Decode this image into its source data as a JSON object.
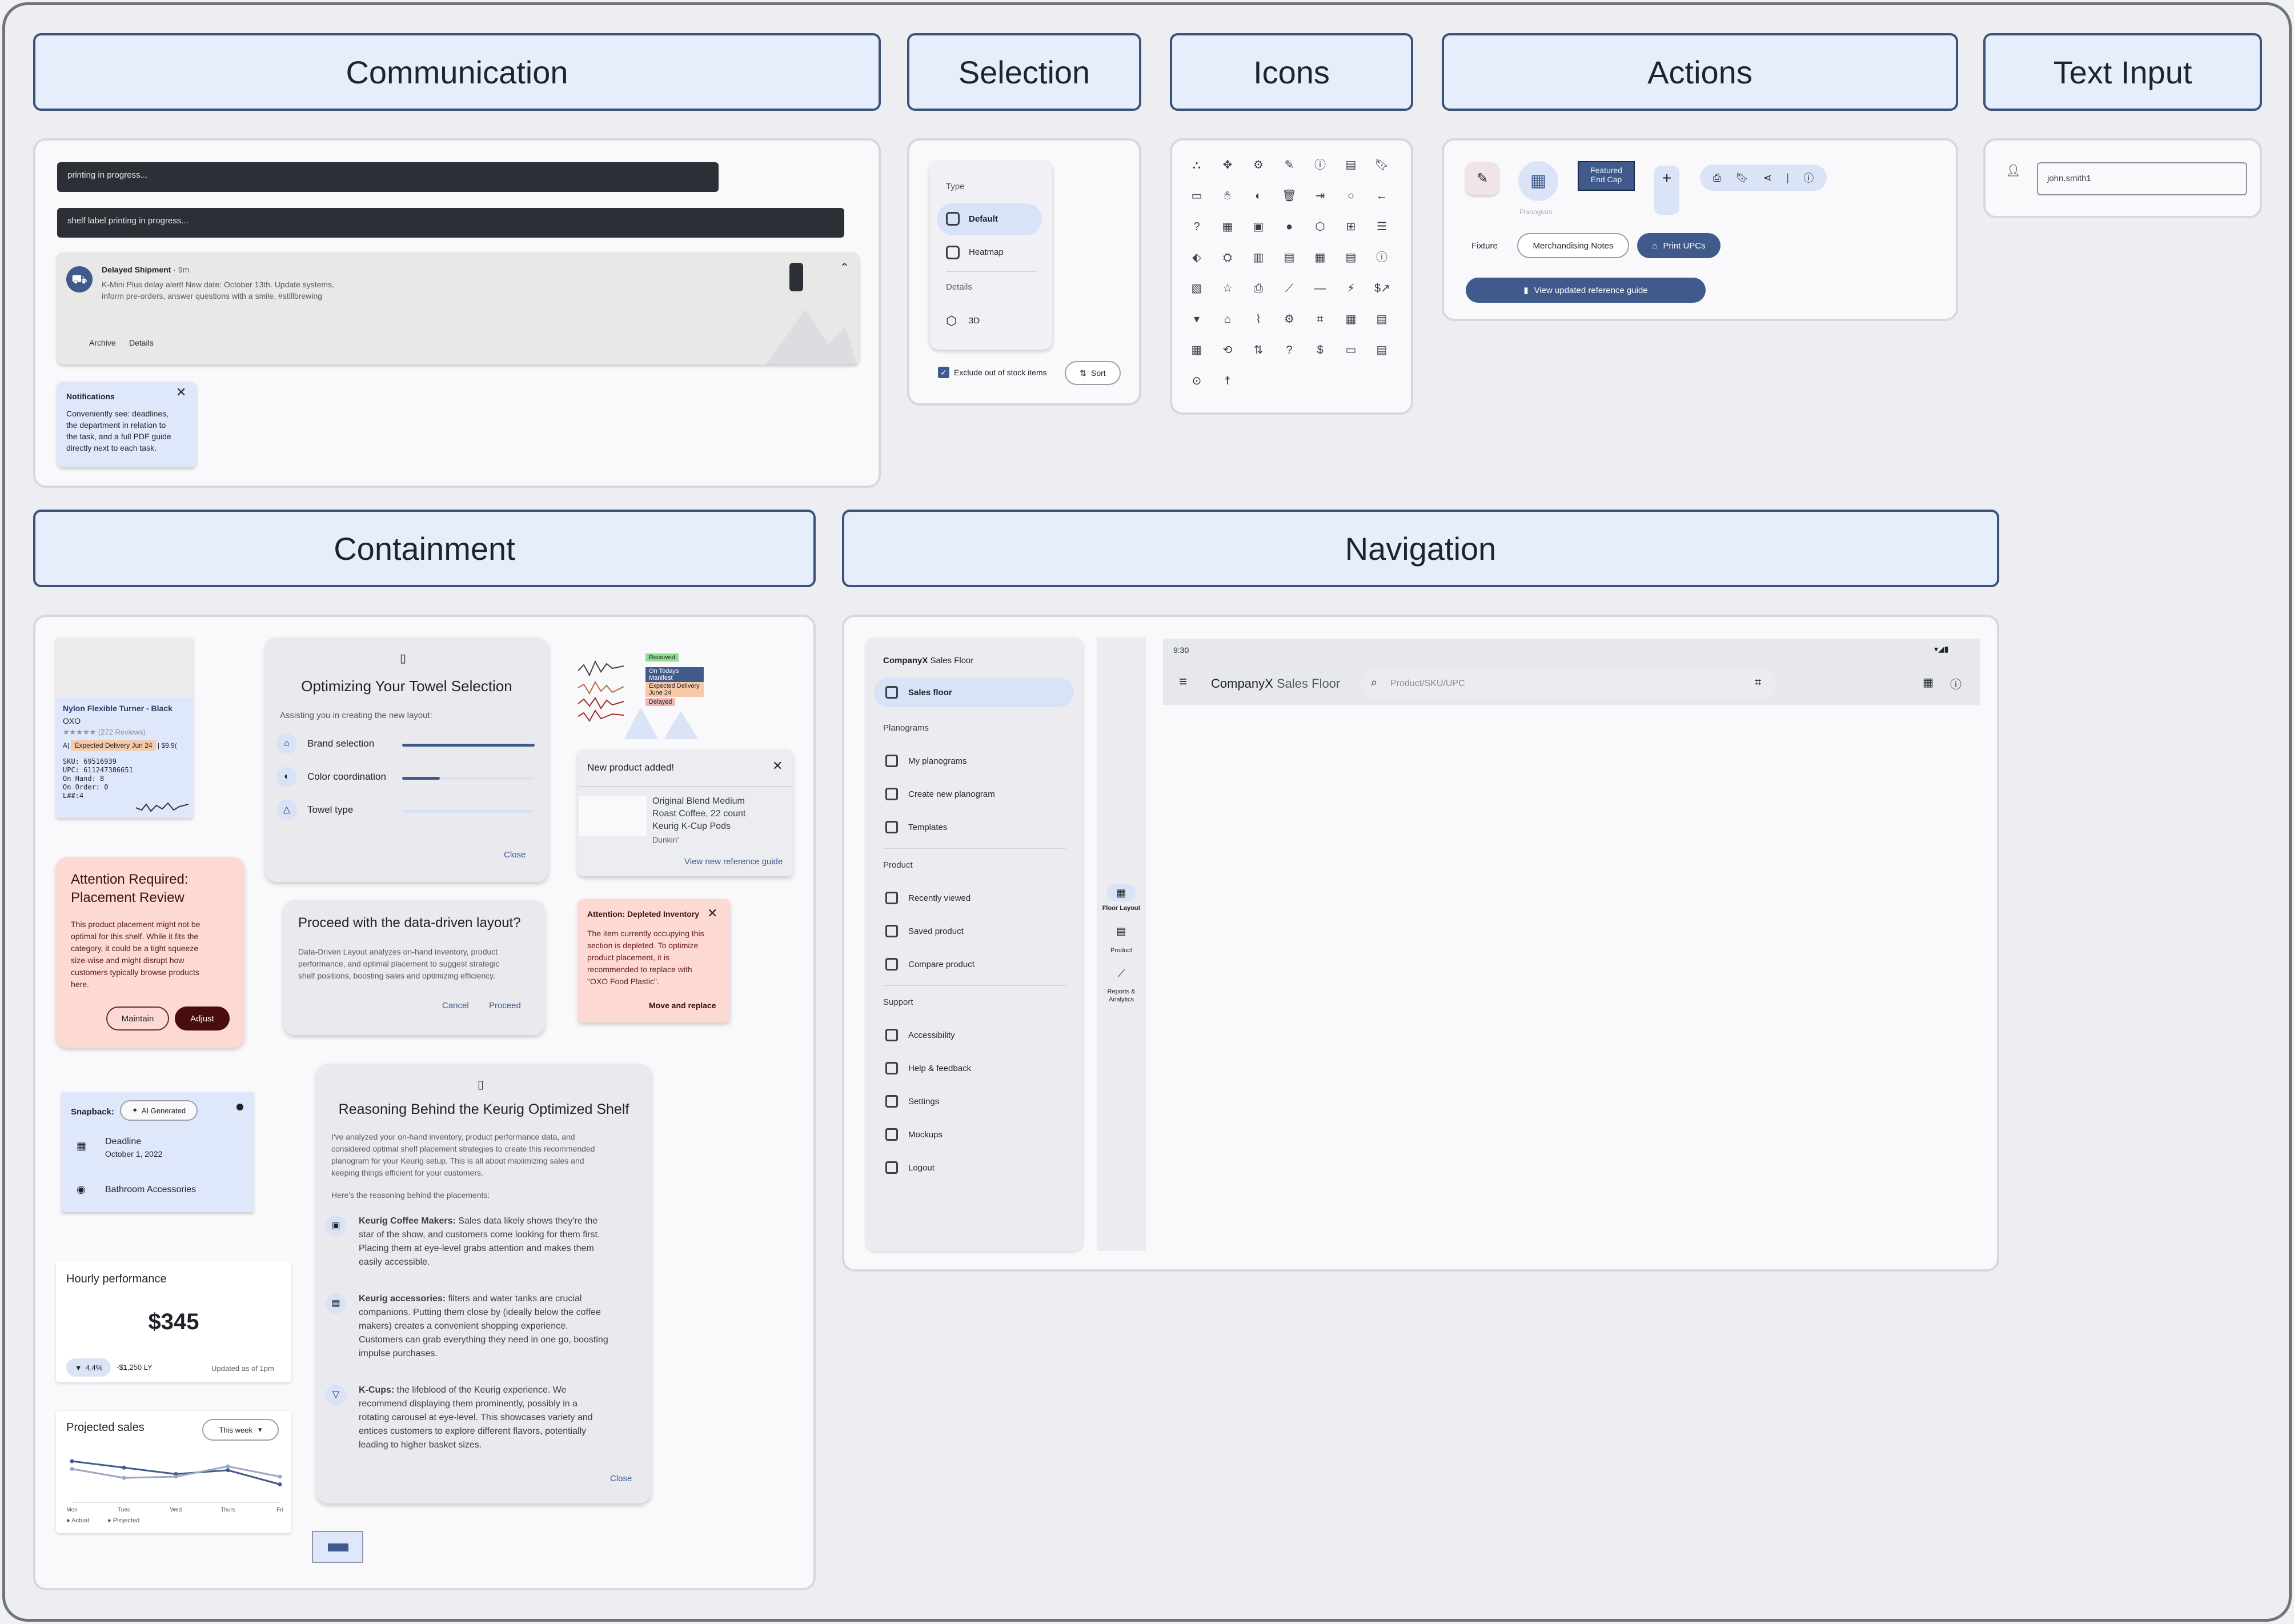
{
  "headers": {
    "communication": "Communication",
    "selection": "Selection",
    "icons": "Icons",
    "actions": "Actions",
    "text_input": "Text Input",
    "containment": "Containment",
    "navigation": "Navigation"
  },
  "communication": {
    "snackbar1": "printing in progress...",
    "snackbar2": "shelf label printing in progress...",
    "shipment": {
      "title": "Delayed Shipment",
      "time": "· 9m",
      "body1": "K-Mini Plus delay alert! New date: October 13th. Update systems,",
      "body2": "inform pre-orders, answer questions with a smile. #stillbrewing",
      "archive": "Archive",
      "details": "Details"
    },
    "notification": {
      "title": "Notifications",
      "l1": "Conveniently see: deadlines,",
      "l2": "the department in relation to",
      "l3": "the task, and a full PDF guide",
      "l4": "directly next to each task."
    }
  },
  "selection": {
    "type_label": "Type",
    "opt_default": "Default",
    "opt_heatmap": "Heatmap",
    "details_label": "Details",
    "opt_3d": "3D",
    "checkbox_label": "Exclude out of stock items",
    "sort_label": "Sort"
  },
  "actions": {
    "featured1": "Featured",
    "featured2": "End Cap",
    "planogram": "Planogram",
    "fixture": "Fixture",
    "merch_notes": "Merchandising Notes",
    "print_upcs": "Print UPCs",
    "view_guide": "View updated reference guide"
  },
  "text_input": {
    "value": "john.smith1"
  },
  "containment": {
    "product": {
      "name": "Nylon Flexible Turner - Black",
      "brand": "OXO",
      "stars": "★★★★★",
      "reviews": "(272 Reviews)",
      "tag_a": "A|",
      "delivery": "Expected Delivery Jun 24",
      "price": "| $9.9(",
      "sku": "SKU: 69516939",
      "upc": "UPC: 611247386651",
      "on_hand": "On Hand: 8",
      "on_order": "On Order: 0",
      "loc": "L##:4"
    },
    "towel": {
      "title": "Optimizing Your Towel Selection",
      "subtitle": "Assisting you in creating the new layout:",
      "r1": "Brand selection",
      "r2": "Color coordination",
      "r3": "Towel type",
      "close": "Close"
    },
    "chips": {
      "received": "Received",
      "manifest": "On Todays Manifest",
      "expected": "Expected Delivery June 24",
      "delayed": "Delayed"
    },
    "new_product": {
      "title": "New product added!",
      "l1": "Original Blend Medium",
      "l2": "Roast Coffee, 22 count",
      "l3": "Keurig K-Cup Pods",
      "brand": "Dunkin'",
      "link": "View new reference guide"
    },
    "attention": {
      "t1": "Attention Required:",
      "t2": "Placement Review",
      "b1": "This product placement might not be",
      "b2": "optimal for this shelf. While it fits the",
      "b3": "category, it could be a tight squeeze",
      "b4": "size-wise and might disrupt how",
      "b5": "customers typically browse products",
      "b6": "here.",
      "maintain": "Maintain",
      "adjust": "Adjust"
    },
    "proceed": {
      "title": "Proceed with the data-driven layout?",
      "b1": "Data-Driven Layout analyzes on-hand inventory, product",
      "b2": "performance, and optimal placement to suggest strategic",
      "b3": "shelf positions, boosting sales and optimizing efficiency.",
      "cancel": "Cancel",
      "proceed": "Proceed"
    },
    "depleted": {
      "title": "Attention: Depleted Inventory",
      "b1": "The item currently occupying this",
      "b2": "section is depleted. To optimize",
      "b3": "product placement, it is",
      "b4": "recommended to replace with",
      "b5": "\"OXO Food Plastic\".",
      "action": "Move and replace"
    },
    "snapback": {
      "title": "Snapback:",
      "ai": "AI Generated",
      "deadline": "Deadline",
      "date": "October 1, 2022",
      "location": "Bathroom Accessories"
    },
    "reasoning": {
      "title": "Reasoning Behind the Keurig Optimized Shelf",
      "p1": [
        "I've analyzed your on-hand inventory, product performance data, and",
        "considered optimal shelf placement strategies to create this recommended",
        "planogram for your Keurig setup. This is all about maximizing sales and",
        "keeping things efficient for your customers."
      ],
      "p2": "Here's the reasoning behind the placements:",
      "i1": {
        "b": "Keurig Coffee Makers:",
        "l": [
          " Sales data likely shows they're the",
          "star of the show, and customers come looking for them first.",
          "Placing them at eye-level grabs attention and makes them",
          "easily accessible."
        ]
      },
      "i2": {
        "b": "Keurig accessories:",
        "l": [
          " filters and water tanks are crucial",
          "companions. Putting them close by (ideally below the coffee",
          "makers) creates a convenient shopping experience.",
          "Customers can grab everything they need in one go, boosting",
          "impulse purchases."
        ]
      },
      "i3": {
        "b": "K-Cups:",
        "l": [
          " the lifeblood of the Keurig experience. We",
          "recommend displaying them prominently, possibly in a",
          "rotating carousel at eye-level. This showcases variety and",
          "entices customers to explore different flavors, potentially",
          "leading to higher basket sizes."
        ]
      },
      "close": "Close"
    },
    "hourly": {
      "title": "Hourly performance",
      "value": "$345",
      "delta": "4.4%",
      "ly": "-$1,250 LY",
      "updated": "Updated as of 1pm"
    },
    "projected": {
      "title": "Projected sales",
      "range": "This week",
      "days": [
        "Mon",
        "Tues",
        "Wed",
        "Thurs",
        "Fri"
      ],
      "actual": "Actual",
      "projected": "Projected"
    }
  },
  "chart_data": {
    "type": "line",
    "categories": [
      "Mon",
      "Tues",
      "Wed",
      "Thurs",
      "Fri"
    ],
    "series": [
      {
        "name": "Actual",
        "values": [
          3.2,
          2.7,
          2.2,
          2.5,
          1.4
        ]
      },
      {
        "name": "Projected",
        "values": [
          2.6,
          1.9,
          2.0,
          2.8,
          2.0
        ]
      }
    ],
    "title": "Projected sales",
    "ylim": [
      0,
      4
    ]
  },
  "navigation": {
    "drawer": {
      "brand": "CompanyX",
      "brand2": "Sales Floor",
      "sales_floor": "Sales floor",
      "planograms": "Planograms",
      "my_planograms": "My planograms",
      "create": "Create new planogram",
      "templates": "Templates",
      "product": "Product",
      "recent": "Recently viewed",
      "saved": "Saved product",
      "compare": "Compare product",
      "support": "Support",
      "accessibility": "Accessibility",
      "help": "Help & feedback",
      "settings": "Settings",
      "mockups": "Mockups",
      "logout": "Logout"
    },
    "rail": {
      "floor": "Floor Layout",
      "product": "Product",
      "reports1": "Reports &",
      "reports2": "Analytics"
    },
    "app": {
      "time": "9:30",
      "brand": "CompanyX",
      "brand2": "Sales Floor",
      "search": "Product/SKU/UPC"
    }
  }
}
